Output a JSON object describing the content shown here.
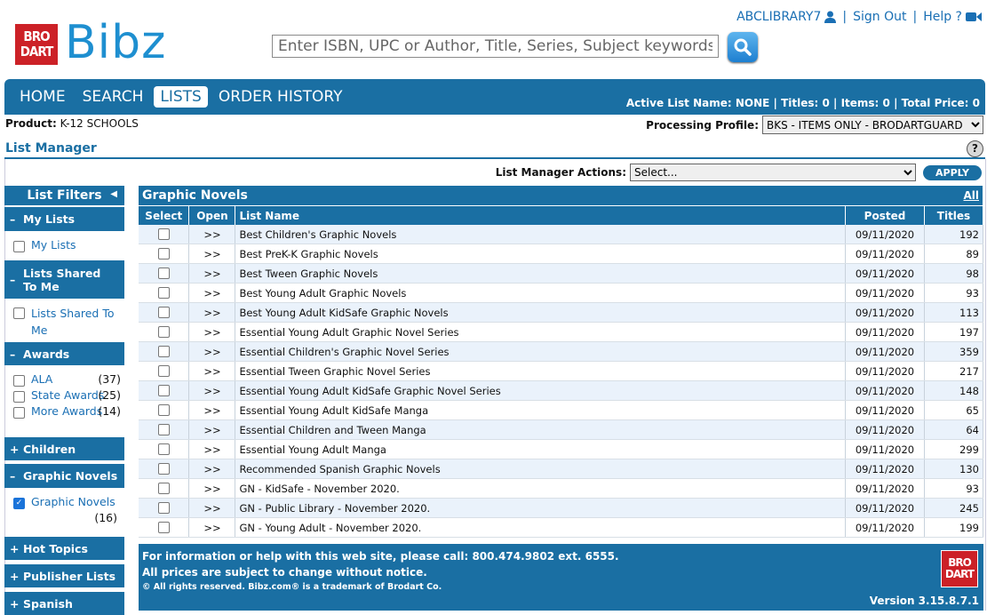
{
  "brand": {
    "logo_line1": "BRO",
    "logo_line2": "DART",
    "wordmark": "Bibz"
  },
  "search": {
    "placeholder": "Enter ISBN, UPC or Author, Title, Series, Subject keywords"
  },
  "user": {
    "account": "ABCLIBRARY7",
    "sign_out": "Sign Out",
    "help": "Help ?"
  },
  "nav": {
    "tabs": [
      {
        "label": "HOME"
      },
      {
        "label": "SEARCH"
      },
      {
        "label": "LISTS"
      },
      {
        "label": "ORDER HISTORY"
      }
    ],
    "active_tab": "LISTS",
    "summary": "Active List Name: NONE  | Titles: 0 | Items: 0 | Total Price: 0"
  },
  "product": {
    "label": "Product:",
    "value": "K-12 SCHOOLS"
  },
  "processing_profile": {
    "label": "Processing Profile:",
    "selected": "BKS - ITEMS ONLY - BRODARTGUARD"
  },
  "list_manager": {
    "title": "List Manager",
    "actions_label": "List Manager Actions:",
    "actions_selected": "Select...",
    "apply": "APPLY"
  },
  "filters": {
    "title": "List Filters",
    "groups": [
      {
        "title": "My Lists",
        "sign": "–",
        "items": [
          {
            "label": "My Lists",
            "count": "",
            "checked": false
          }
        ]
      },
      {
        "title": "Lists Shared To Me",
        "sign": "–",
        "items": [
          {
            "label": "Lists Shared To Me",
            "count": "",
            "checked": false
          }
        ]
      },
      {
        "title": "Awards",
        "sign": "–",
        "items": [
          {
            "label": "ALA",
            "count": "(37)",
            "checked": false
          },
          {
            "label": "State Awards",
            "count": "(25)",
            "checked": false
          },
          {
            "label": "More Awards",
            "count": "(14)",
            "checked": false
          }
        ]
      },
      {
        "title": "Children",
        "sign": "+",
        "items": []
      },
      {
        "title": "Graphic Novels",
        "sign": "–",
        "items": [
          {
            "label": "Graphic Novels",
            "count": "(16)",
            "checked": true
          }
        ]
      },
      {
        "title": "Hot Topics",
        "sign": "+",
        "items": []
      },
      {
        "title": "Publisher Lists",
        "sign": "+",
        "items": []
      },
      {
        "title": "Spanish",
        "sign": "+",
        "items": []
      }
    ]
  },
  "content": {
    "heading": "Graphic Novels",
    "all_link": "All",
    "columns": [
      "Select",
      "Open",
      "List Name",
      "Posted",
      "Titles"
    ],
    "open_glyph": ">>",
    "rows": [
      {
        "name": "Best Children's Graphic Novels",
        "posted": "09/11/2020",
        "titles": "192"
      },
      {
        "name": "Best PreK-K Graphic Novels",
        "posted": "09/11/2020",
        "titles": "89"
      },
      {
        "name": "Best Tween Graphic Novels",
        "posted": "09/11/2020",
        "titles": "98"
      },
      {
        "name": "Best Young Adult Graphic Novels",
        "posted": "09/11/2020",
        "titles": "93"
      },
      {
        "name": "Best Young Adult KidSafe Graphic Novels",
        "posted": "09/11/2020",
        "titles": "113"
      },
      {
        "name": "Essential Young Adult Graphic Novel Series",
        "posted": "09/11/2020",
        "titles": "197"
      },
      {
        "name": "Essential Children's Graphic Novel Series",
        "posted": "09/11/2020",
        "titles": "359"
      },
      {
        "name": "Essential Tween Graphic Novel Series",
        "posted": "09/11/2020",
        "titles": "217"
      },
      {
        "name": "Essential Young Adult KidSafe Graphic Novel Series",
        "posted": "09/11/2020",
        "titles": "148"
      },
      {
        "name": "Essential Young Adult KidSafe Manga",
        "posted": "09/11/2020",
        "titles": "65"
      },
      {
        "name": "Essential Children and Tween Manga",
        "posted": "09/11/2020",
        "titles": "64"
      },
      {
        "name": "Essential Young Adult Manga",
        "posted": "09/11/2020",
        "titles": "299"
      },
      {
        "name": "Recommended Spanish Graphic Novels",
        "posted": "09/11/2020",
        "titles": "130"
      },
      {
        "name": "GN - KidSafe - November 2020.",
        "posted": "09/11/2020",
        "titles": "93"
      },
      {
        "name": "GN - Public Library - November 2020.",
        "posted": "09/11/2020",
        "titles": "245"
      },
      {
        "name": "GN - Young Adult - November 2020.",
        "posted": "09/11/2020",
        "titles": "199"
      }
    ]
  },
  "footer": {
    "line1": "For information or help with this web site, please call: 800.474.9802 ext. 6555.",
    "line2": "All prices are subject to change without notice.",
    "line3": "© All rights reserved. Bibz.com® is a trademark of Brodart Co.",
    "version": "Version 3.15.8.7.1"
  },
  "colors": {
    "primary": "#1a6fa3",
    "brand_red": "#cc2127",
    "link": "#1a6fb4",
    "row_alt": "#eaf2fb"
  }
}
